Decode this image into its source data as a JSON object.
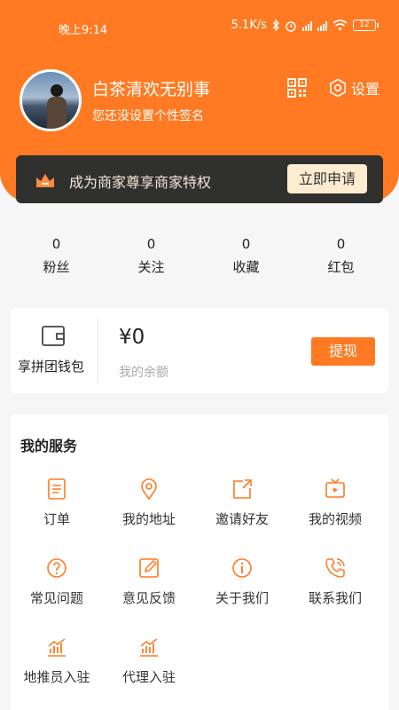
{
  "status_bar": {
    "time": "晚上9:14",
    "speed": "5.1K/s",
    "battery": "12"
  },
  "profile": {
    "username": "白茶清欢无别事",
    "signature": "您还没设置个性签名",
    "settings_label": "设置"
  },
  "merchant": {
    "text": "成为商家尊享商家特权",
    "button_label": "立即申请"
  },
  "stats": [
    {
      "value": "0",
      "label": "粉丝"
    },
    {
      "value": "0",
      "label": "关注"
    },
    {
      "value": "0",
      "label": "收藏"
    },
    {
      "value": "0",
      "label": "红包"
    }
  ],
  "wallet": {
    "label": "享拼团钱包",
    "amount": "¥0",
    "balance_label": "我的余额",
    "withdraw_label": "提现"
  },
  "services": {
    "title": "我的服务",
    "items": [
      {
        "label": "订单",
        "icon": "order-icon"
      },
      {
        "label": "我的地址",
        "icon": "location-icon"
      },
      {
        "label": "邀请好友",
        "icon": "share-icon"
      },
      {
        "label": "我的视频",
        "icon": "video-icon"
      },
      {
        "label": "常见问题",
        "icon": "question-icon"
      },
      {
        "label": "意见反馈",
        "icon": "feedback-icon"
      },
      {
        "label": "关于我们",
        "icon": "info-icon"
      },
      {
        "label": "联系我们",
        "icon": "phone-icon"
      },
      {
        "label": "地推员入驻",
        "icon": "chart-icon"
      },
      {
        "label": "代理入驻",
        "icon": "chart-icon"
      }
    ]
  },
  "colors": {
    "accent": "#ff7a22",
    "dark_banner": "#30302f",
    "apply_bg": "#fdeccf"
  }
}
